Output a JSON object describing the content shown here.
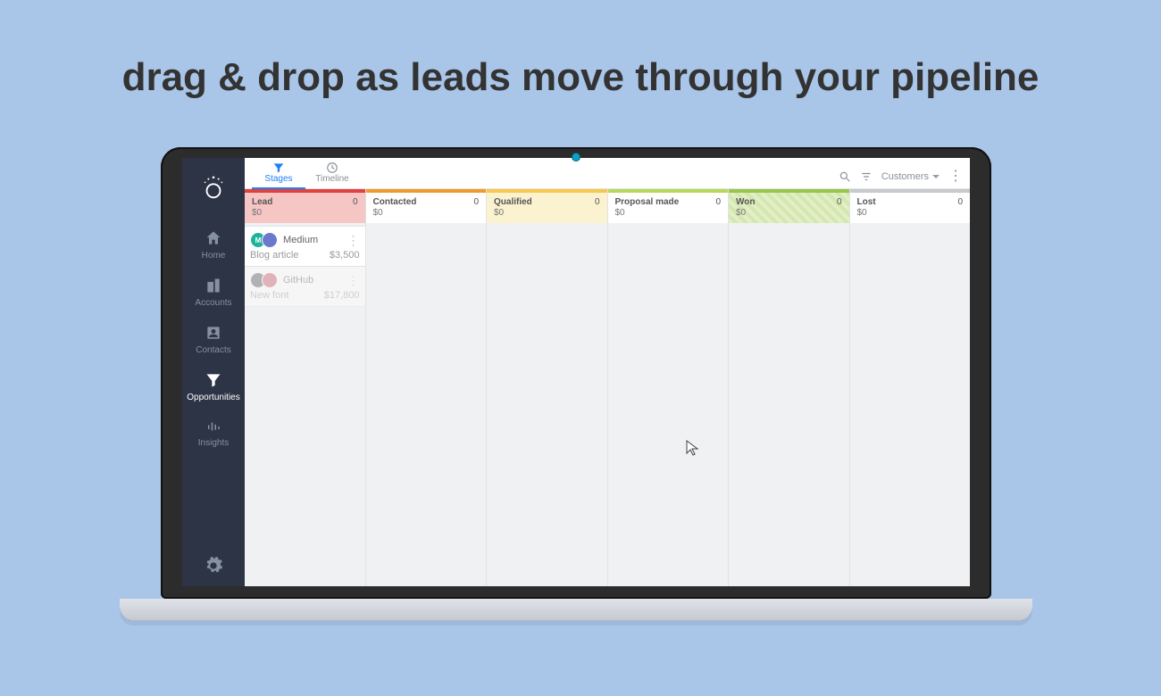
{
  "headline": "drag & drop as leads move through your pipeline",
  "sidebar": {
    "items": [
      {
        "label": "Home"
      },
      {
        "label": "Accounts"
      },
      {
        "label": "Contacts"
      },
      {
        "label": "Opportunities"
      },
      {
        "label": "Insights"
      }
    ]
  },
  "views": {
    "stages": "Stages",
    "timeline": "Timeline"
  },
  "filter_dropdown": "Customers",
  "columns": [
    {
      "key": "lead",
      "title": "Lead",
      "count": "0",
      "amount": "$0"
    },
    {
      "key": "contacted",
      "title": "Contacted",
      "count": "0",
      "amount": "$0"
    },
    {
      "key": "qualified",
      "title": "Qualified",
      "count": "0",
      "amount": "$0"
    },
    {
      "key": "proposal",
      "title": "Proposal made",
      "count": "0",
      "amount": "$0"
    },
    {
      "key": "won",
      "title": "Won",
      "count": "0",
      "amount": "$0"
    },
    {
      "key": "lost",
      "title": "Lost",
      "count": "0",
      "amount": "$0"
    }
  ],
  "cards": {
    "lead": [
      {
        "company": "Medium",
        "subject": "Blog article",
        "value": "$3,500",
        "avatars": [
          "M",
          "•"
        ],
        "colors": [
          "#1eb39b",
          "#6c78cc"
        ]
      },
      {
        "company": "GitHub",
        "subject": "New font",
        "value": "$17,800",
        "avatars": [
          "G",
          "•"
        ],
        "colors": [
          "#555",
          "#c9576a"
        ],
        "dragging": true
      }
    ]
  }
}
